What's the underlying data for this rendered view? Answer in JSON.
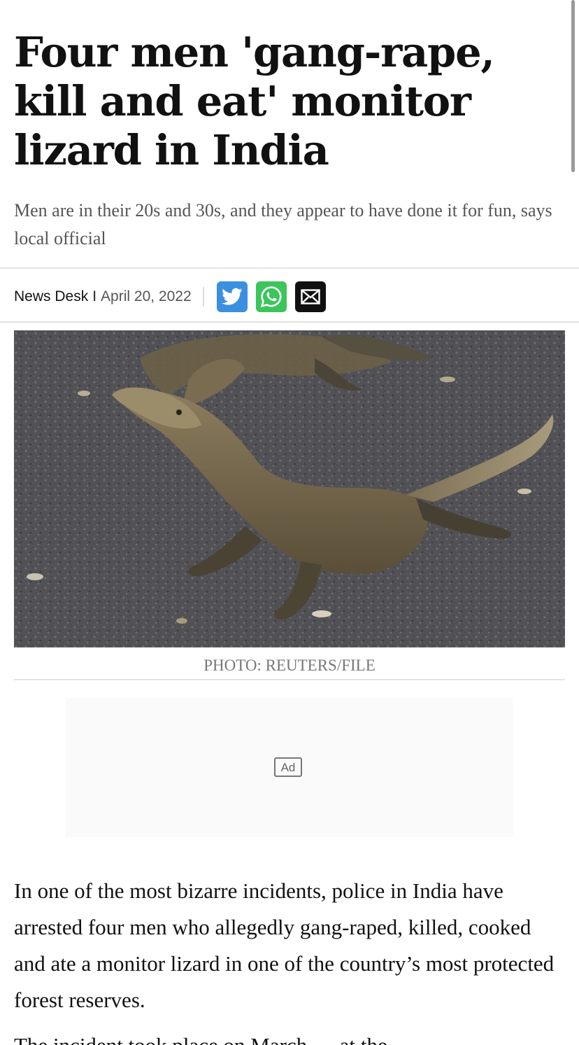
{
  "article": {
    "headline": "Four men 'gang-rape, kill and eat' monitor lizard in India",
    "subheadline": "Men are in their 20s and 30s, and they appear to have done it for fun, says local official",
    "byline": {
      "author": "News Desk",
      "separator": "I",
      "date": "April 20, 2022"
    },
    "share": [
      {
        "network": "twitter",
        "icon": "twitter-icon",
        "color": "#3a8fe0"
      },
      {
        "network": "whatsapp",
        "icon": "whatsapp-icon",
        "color": "#3cc55a"
      },
      {
        "network": "email",
        "icon": "envelope-icon",
        "color": "#111111"
      }
    ],
    "photo": {
      "subject": "monitor-lizard-photo",
      "caption": "PHOTO: REUTERS/FILE"
    },
    "ad": {
      "label": "Ad"
    },
    "body": [
      "In one of the most bizarre incidents, police in India have arrested four men who allegedly gang-raped, killed, cooked and ate a monitor lizard in one of the country’s most protected forest reserves.",
      "The incident took place on March … at the"
    ]
  }
}
